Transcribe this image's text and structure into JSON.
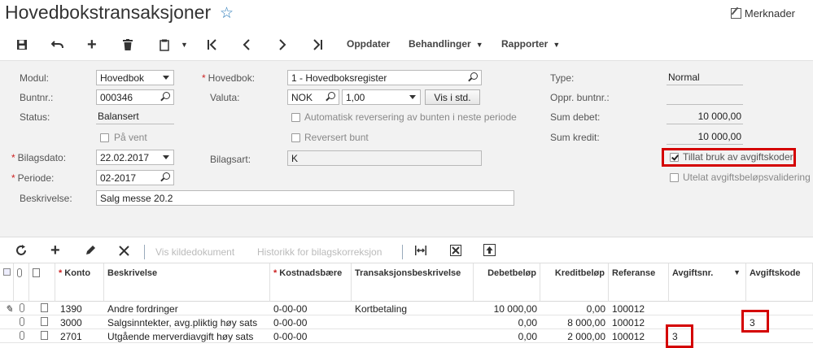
{
  "header": {
    "title": "Hovedbokstransaksjoner",
    "notes_label": "Merknader"
  },
  "toolbar": {
    "oppdater": "Oppdater",
    "behandlinger": "Behandlinger",
    "rapporter": "Rapporter"
  },
  "form": {
    "modul_label": "Modul:",
    "modul_value": "Hovedbok",
    "buntnr_label": "Buntnr.:",
    "buntnr_value": "000346",
    "status_label": "Status:",
    "status_value": "Balansert",
    "pa_vent_label": "På vent",
    "bilagsdato_label": "Bilagsdato:",
    "bilagsdato_value": "22.02.2017",
    "periode_label": "Periode:",
    "periode_value": "02-2017",
    "beskrivelse_label": "Beskrivelse:",
    "beskrivelse_value": "Salg messe 20.2",
    "hovedbok_label": "Hovedbok:",
    "hovedbok_value": "1 - Hovedboksregister",
    "valuta_label": "Valuta:",
    "valuta_value": "NOK",
    "kurs_value": "1,00",
    "vis_i_std": "Vis i std.",
    "auto_rev_label": "Automatisk reversering av bunten i neste periode",
    "reversert_label": "Reversert bunt",
    "bilagsart_label": "Bilagsart:",
    "bilagsart_value": "K",
    "type_label": "Type:",
    "type_value": "Normal",
    "oppr_label": "Oppr. buntnr.:",
    "oppr_value": "",
    "sum_debet_label": "Sum debet:",
    "sum_debet_value": "10 000,00",
    "sum_kredit_label": "Sum kredit:",
    "sum_kredit_value": "10 000,00",
    "tillat_label": "Tillat bruk av avgiftskoder",
    "utelat_label": "Utelat avgiftsbeløpsvalidering"
  },
  "gridbar": {
    "vis_kilde": "Vis kildedokument",
    "historikk": "Historikk for bilagskorreksjon"
  },
  "grid": {
    "headers": {
      "konto": "Konto",
      "beskrivelse": "Beskrivelse",
      "kostnad": "Kostnadsbære",
      "transbeskr": "Transaksjonsbeskrivelse",
      "debet": "Debetbeløp",
      "kredit": "Kreditbeløp",
      "referanse": "Referanse",
      "avgiftsnr": "Avgiftsnr.",
      "avgiftskode": "Avgiftskode"
    },
    "rows": [
      {
        "konto": "1390",
        "beskrivelse": "Andre fordringer",
        "kostnad": "0-00-00",
        "transbeskr": "Kortbetaling",
        "debet": "10 000,00",
        "kredit": "0,00",
        "referanse": "100012",
        "avgiftsnr": "",
        "avgiftskode": ""
      },
      {
        "konto": "3000",
        "beskrivelse": "Salgsinntekter, avg.pliktig høy sats",
        "kostnad": "0-00-00",
        "transbeskr": "",
        "debet": "0,00",
        "kredit": "8 000,00",
        "referanse": "100012",
        "avgiftsnr": "",
        "avgiftskode": "3"
      },
      {
        "konto": "2701",
        "beskrivelse": "Utgående merverdiavgift høy sats",
        "kostnad": "0-00-00",
        "transbeskr": "",
        "debet": "0,00",
        "kredit": "2 000,00",
        "referanse": "100012",
        "avgiftsnr": "3",
        "avgiftskode": ""
      }
    ]
  },
  "colors": {
    "highlight": "#d40000",
    "form_bg": "#f2f2f2",
    "star": "#2a7ab8"
  }
}
